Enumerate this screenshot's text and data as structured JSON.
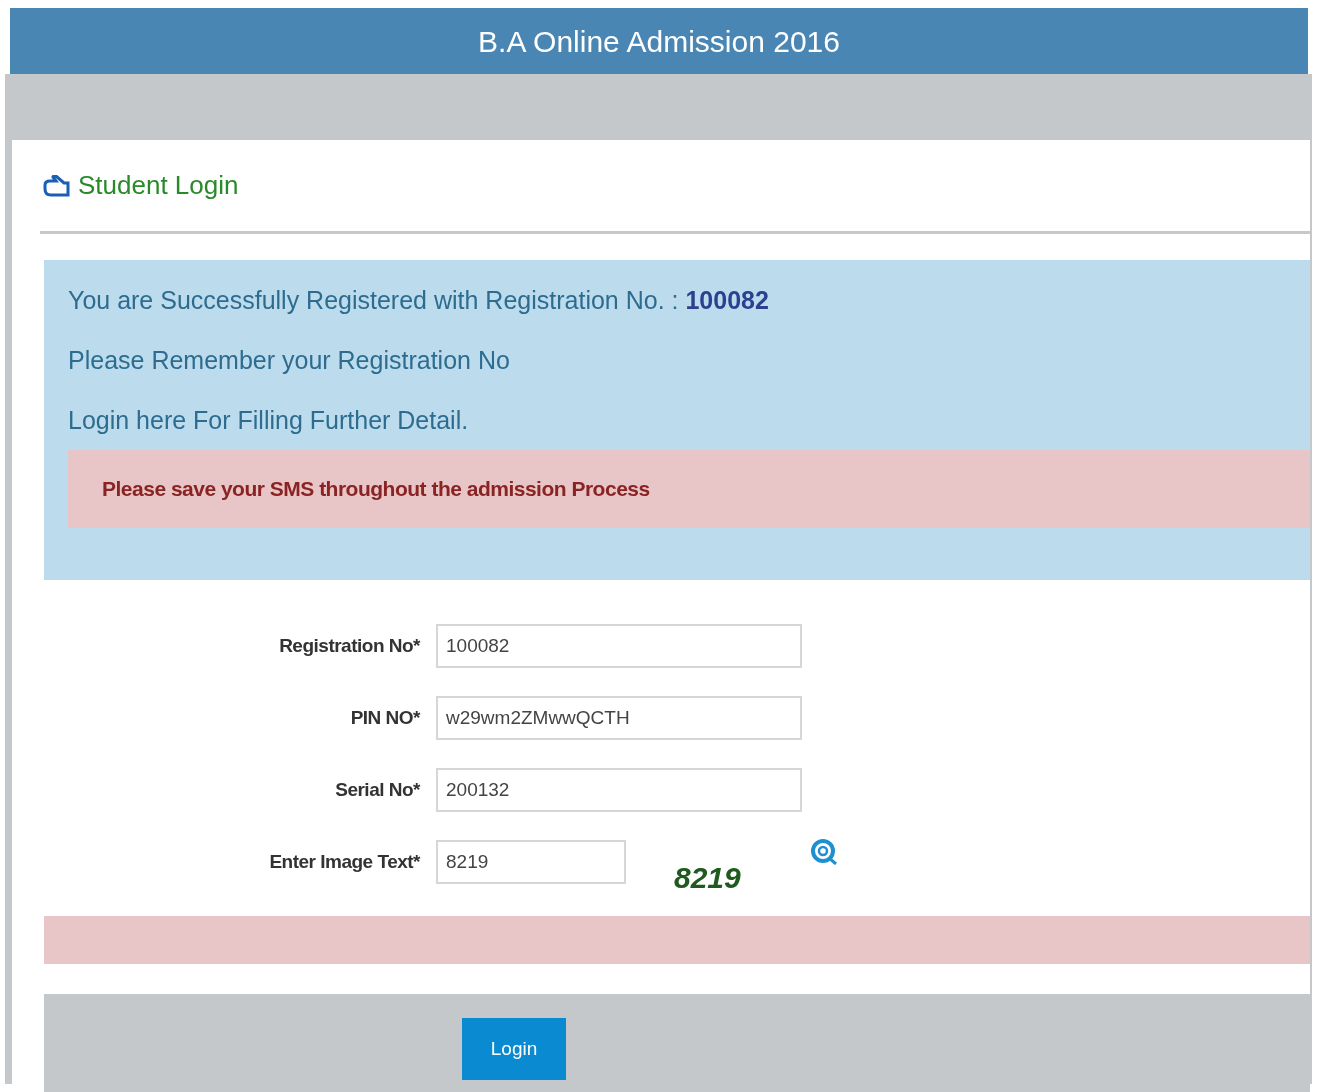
{
  "header": {
    "title": "B.A Online Admission 2016"
  },
  "panel": {
    "title": "Student Login"
  },
  "info": {
    "lines": [
      "You are Successfully Registered with Registration No. : **100082**",
      "Please Remember your Registration No",
      "Login here For Filling Further Detail."
    ],
    "alert": "Please save your SMS throughout the admission Process"
  },
  "form": {
    "fields": [
      {
        "label": "Registration No*",
        "value": "100082",
        "kind": "text"
      },
      {
        "label": "PIN NO*",
        "value": "w29wm2ZMwwQCTH",
        "kind": "text"
      },
      {
        "label": "Serial No*",
        "value": "200132",
        "kind": "text"
      },
      {
        "label": "Enter Image Text*",
        "value": "8219",
        "kind": "captcha",
        "captcha": "8219"
      }
    ]
  },
  "buttons": [
    "Login"
  ]
}
